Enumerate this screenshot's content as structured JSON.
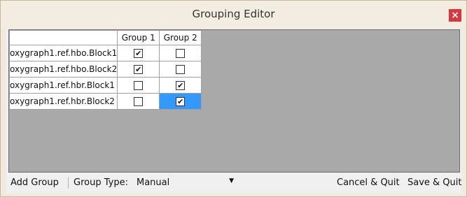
{
  "window": {
    "title": "Grouping Editor",
    "close_glyph": "×"
  },
  "grid": {
    "columns": [
      "Group 1",
      "Group 2"
    ],
    "rows": [
      {
        "label": "oxygraph1.ref.hbo.Block1",
        "values": [
          true,
          false
        ]
      },
      {
        "label": "oxygraph1.ref.hbo.Block2",
        "values": [
          true,
          false
        ]
      },
      {
        "label": "oxygraph1.ref.hbr.Block1",
        "values": [
          false,
          true
        ]
      },
      {
        "label": "oxygraph1.ref.hbr.Block2",
        "values": [
          false,
          true
        ]
      }
    ],
    "selected_cell": {
      "row": 3,
      "col": 1
    },
    "check_glyph": "✔"
  },
  "toolbar": {
    "add_group_label": "Add Group",
    "group_type_label": "Group Type:",
    "group_type_value": "Manual",
    "dropdown_arrow": "▼",
    "cancel_label": "Cancel & Quit",
    "save_label": "Save & Quit"
  },
  "colors": {
    "selection": "#3399ff",
    "close_button": "#d9363e",
    "grid_background": "#a9a9a9"
  },
  "icons": {
    "close": "close-icon",
    "dropdown": "chevron-down-icon",
    "checkbox": "checkbox-icon"
  }
}
